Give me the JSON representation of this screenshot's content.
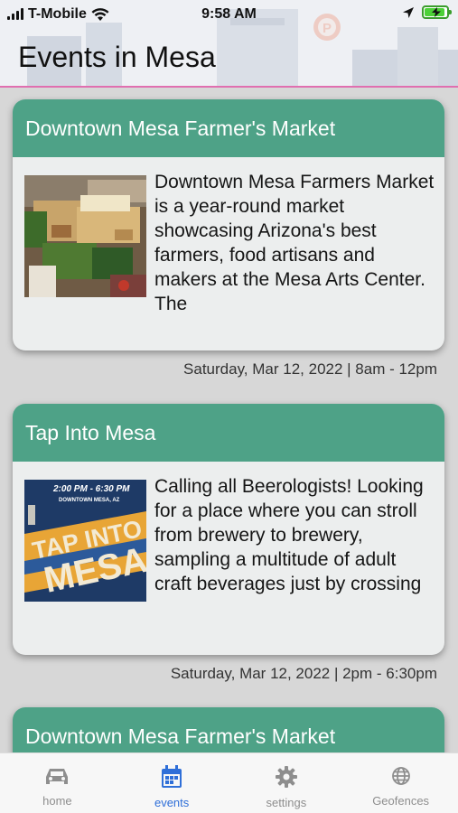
{
  "status_bar": {
    "carrier": "T-Mobile",
    "time": "9:58 AM",
    "battery_level": 0.85
  },
  "header": {
    "title": "Events in Mesa"
  },
  "events": [
    {
      "title": "Downtown Mesa Farmer's Market",
      "description": "Downtown Mesa Farmers Market is a year-round market showcasing Arizona's best farmers, food artisans and makers at the Mesa Arts Center. The",
      "datetime": "Saturday, Mar 12, 2022 | 8am - 12pm",
      "image": "farmers-market-photo"
    },
    {
      "title": "Tap Into Mesa",
      "description": "Calling all Beerologists! Looking for a place where you can stroll from brewery to brewery, sampling a multitude of adult craft beverages just by crossing",
      "datetime": "Saturday, Mar 12, 2022 | 2pm - 6:30pm",
      "image": "tap-into-mesa-poster",
      "poster": {
        "time_line": "2:00 PM - 6:30 PM",
        "place_line": "DOWNTOWN MESA, AZ",
        "word1": "TAP INTO",
        "word2": "MESA"
      }
    },
    {
      "title": "Downtown Mesa Farmer's Market"
    }
  ],
  "tabs": [
    {
      "label": "home",
      "icon": "car-icon",
      "active": false
    },
    {
      "label": "events",
      "icon": "calendar-icon",
      "active": true
    },
    {
      "label": "settings",
      "icon": "gear-icon",
      "active": false
    },
    {
      "label": "Geofences",
      "icon": "globe-icon",
      "active": false
    }
  ],
  "colors": {
    "card_header": "#4ea287",
    "active_tab": "#2f6fd8",
    "header_divider": "#e06fb0"
  }
}
